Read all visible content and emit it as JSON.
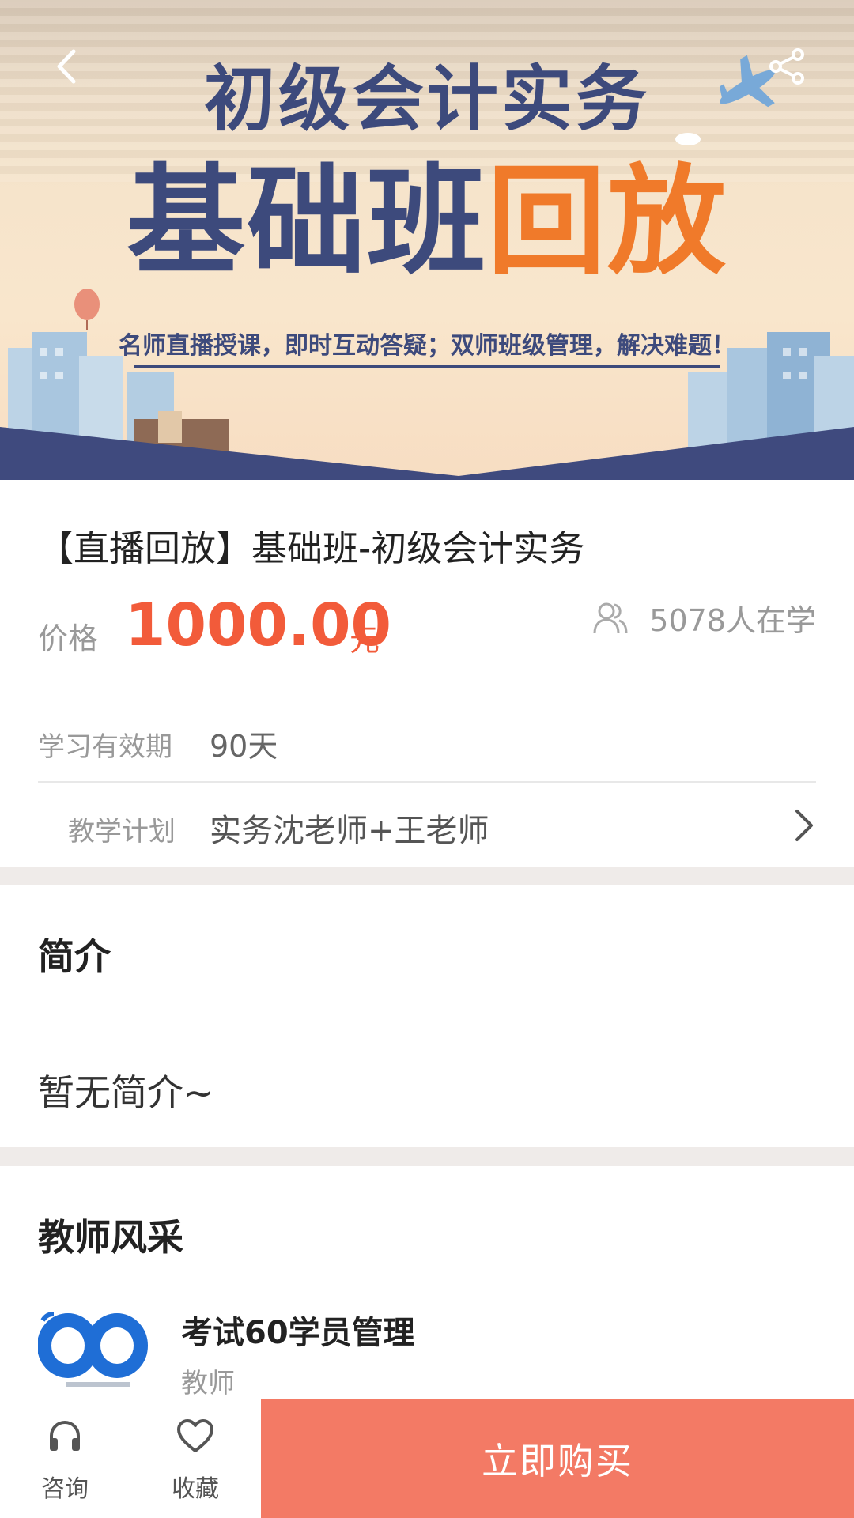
{
  "banner": {
    "title_line1": "初级会计实务",
    "title_line2_part1": "基础班",
    "title_line2_part2": "回放",
    "slogan": "名师直播授课，即时互动答疑；双师班级管理，解决难题！"
  },
  "course": {
    "title": "【直播回放】基础班-初级会计实务",
    "price_label": "价格",
    "price_value": "1000.00",
    "price_unit": "元",
    "learners": "5078人在学",
    "validity_label": "学习有效期",
    "validity_value": "90天",
    "plan_label": "教学计划",
    "plan_value": "实务沈老师+王老师"
  },
  "intro": {
    "title": "简介",
    "text": "暂无简介~"
  },
  "teachers": {
    "title": "教师风采",
    "items": [
      {
        "name": "考试60学员管理",
        "role": "教师"
      }
    ]
  },
  "bottom_bar": {
    "consult_label": "咨询",
    "favorite_label": "收藏",
    "buy_label": "立即购买"
  },
  "colors": {
    "accent_price": "#f25b3a",
    "buy_button": "#f37a65",
    "banner_navy": "#3d4a7c",
    "banner_orange": "#f07a2a"
  },
  "icons": {
    "back": "chevron-left-icon",
    "share": "share-icon",
    "learners": "users-icon",
    "plan_more": "chevron-right-icon",
    "consult": "headset-icon",
    "favorite": "heart-icon"
  }
}
